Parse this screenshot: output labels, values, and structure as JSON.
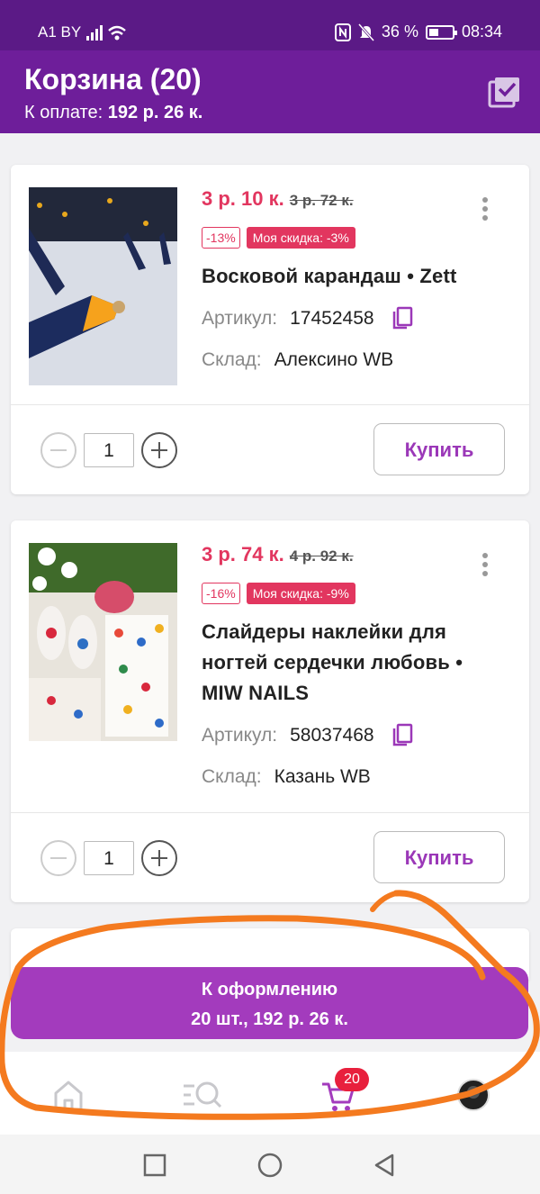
{
  "status_bar": {
    "carrier": "A1 BY",
    "battery": "36 %",
    "time": "08:34"
  },
  "header": {
    "title": "Корзина (20)",
    "to_pay_label": "К оплате:",
    "to_pay_value": "192 р. 26 к."
  },
  "items": [
    {
      "price": "3 р. 10 к.",
      "old_price": "3 р. 72 к.",
      "discount": "-13%",
      "my_discount": "Моя скидка: -3%",
      "name": "Восковой карандаш • Zett",
      "article_label": "Артикул:",
      "article": "17452458",
      "warehouse_label": "Склад:",
      "warehouse": "Алексино WB",
      "quantity": "1",
      "buy_label": "Купить"
    },
    {
      "price": "3 р. 74 к.",
      "old_price": "4 р. 92 к.",
      "discount": "-16%",
      "my_discount": "Моя скидка: -9%",
      "name": "Слайдеры наклейки для ногтей сердечки любовь • MIW NAILS",
      "article_label": "Артикул:",
      "article": "58037468",
      "warehouse_label": "Склад:",
      "warehouse": "Казань WB",
      "quantity": "1",
      "buy_label": "Купить"
    }
  ],
  "checkout": {
    "title": "К оформлению",
    "summary": "20 шт., 192 р. 26 к."
  },
  "bottom_nav": {
    "cart_badge": "20",
    "icons": [
      "home-icon",
      "catalog-search-icon",
      "cart-icon",
      "profile-icon"
    ]
  },
  "colors": {
    "status_bar": "#5b1a86",
    "app_bar": "#6e1e9a",
    "price": "#e2365f",
    "checkout": "#a33bbd",
    "annotation": "#f47a1f"
  }
}
